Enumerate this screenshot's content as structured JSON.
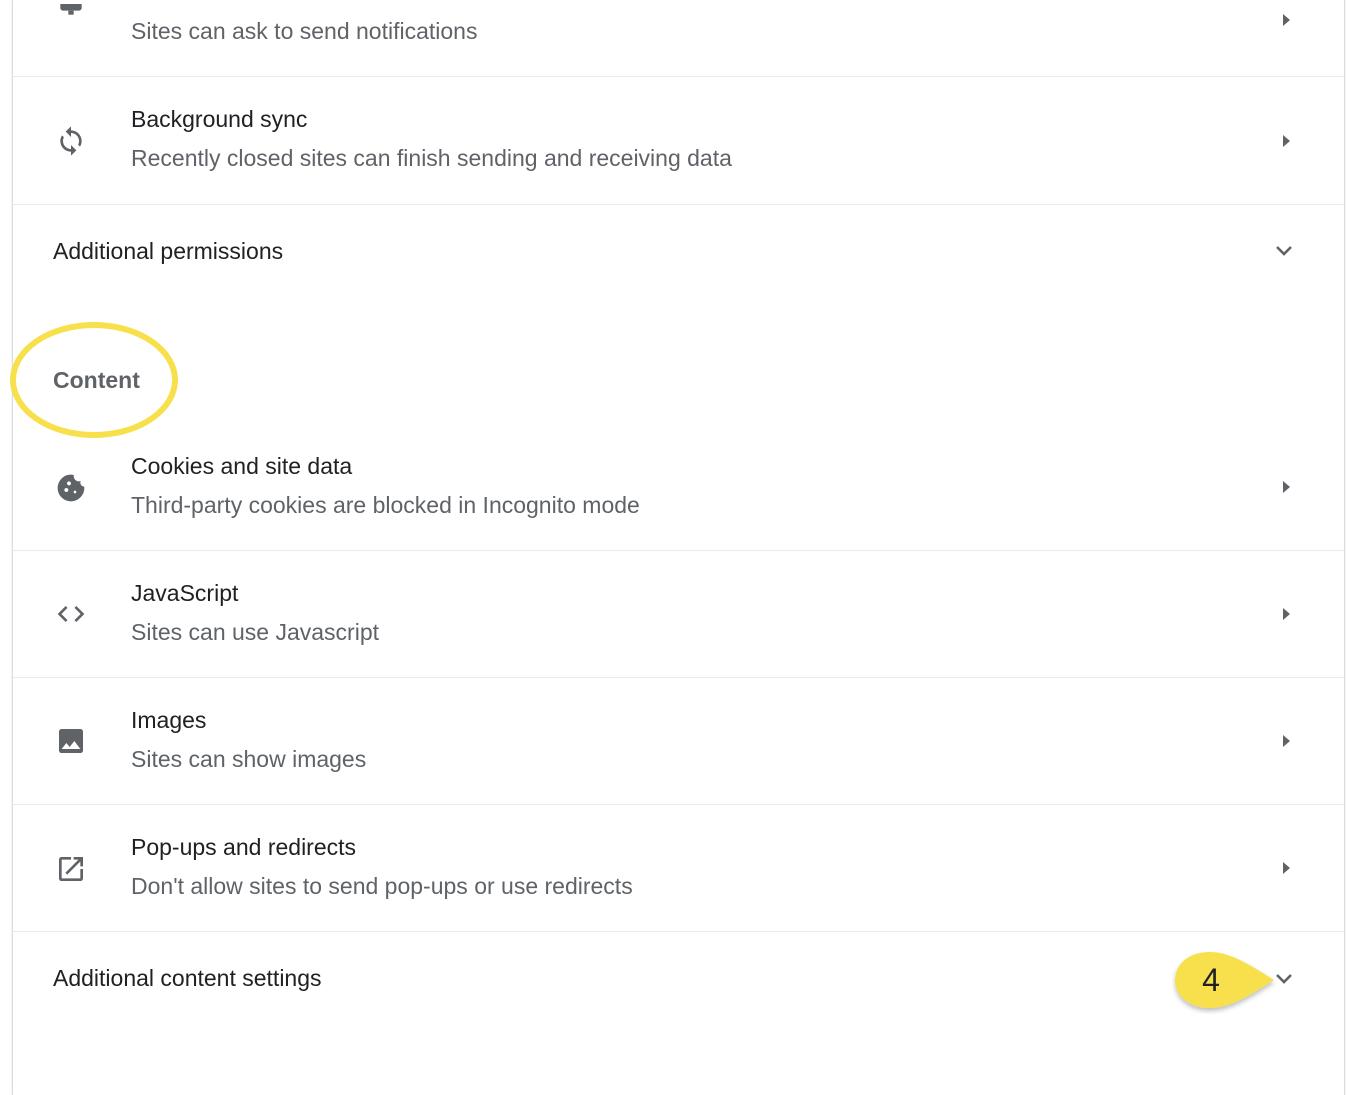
{
  "top_partial_row": {
    "subtitle": "Sites can ask to send notifications",
    "icon": "bell-icon"
  },
  "permission_rows": [
    {
      "title": "Background sync",
      "subtitle": "Recently closed sites can finish sending and receiving data",
      "icon": "sync-icon"
    }
  ],
  "additional_permissions": {
    "label": "Additional permissions"
  },
  "content_section": {
    "heading": "Content"
  },
  "content_rows": [
    {
      "title": "Cookies and site data",
      "subtitle": "Third-party cookies are blocked in Incognito mode",
      "icon": "cookie-icon"
    },
    {
      "title": "JavaScript",
      "subtitle": "Sites can use Javascript",
      "icon": "code-icon"
    },
    {
      "title": "Images",
      "subtitle": "Sites can show images",
      "icon": "image-icon"
    },
    {
      "title": "Pop-ups and redirects",
      "subtitle": "Don't allow sites to send pop-ups or use redirects",
      "icon": "open-in-new-icon"
    }
  ],
  "additional_content_settings": {
    "label": "Additional content settings"
  },
  "annotation": {
    "step_number": "4",
    "callout_color": "#f7e04b",
    "ring_color": "#f7e04b"
  }
}
